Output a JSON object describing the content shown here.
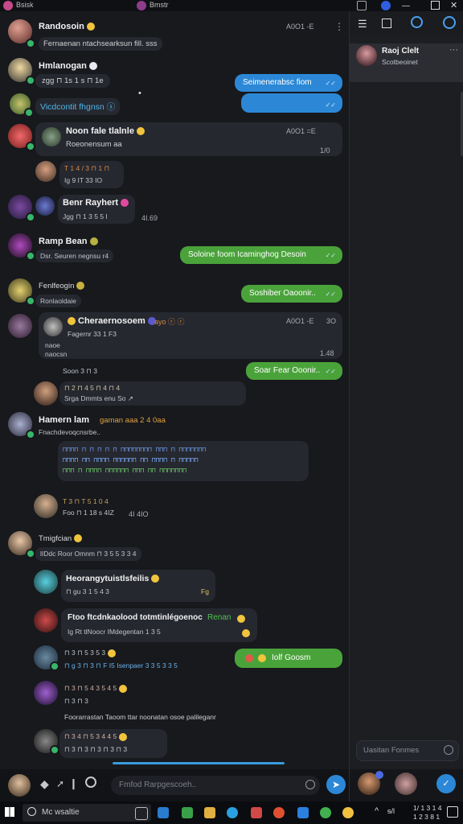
{
  "window": {
    "tab1": "Bsisk",
    "tab2": "Bmstr"
  },
  "chat": {
    "messages": [
      {
        "name": "Randosoin",
        "sub": "Fernaenan ntachsearksun fill.  sss",
        "meta": "A0O1 -E"
      },
      {
        "name": "Hmlanogan",
        "sub": "zgg ⊓ 1s 1 s ⊓ 1e"
      },
      {
        "name": "Vicdcontit fhgnsn  ⓢ"
      },
      {
        "name": "Noon fale tlalnle",
        "sub": "Roeonensum aa",
        "meta": "A0O1 =E",
        "meta2": "1/0"
      },
      {
        "name": "T 1 4 / 3 ⊓ 1 ⊓",
        "sub": "Ig 9 IT 33 IO"
      },
      {
        "name": "Benr Rayhert",
        "sub": "Jgg ⊓ 1 3 5 5 I",
        "meta": "4I.69"
      },
      {
        "name": "Ramp Bean",
        "sub": "Dsr. Seuren negnsu  r4"
      },
      {
        "name": "Fenlfeogin",
        "sub": "Ronlaoldaie"
      },
      {
        "name": "Cheraernosoem",
        "sub": "Fagernr 33 1 F3",
        "meta": "A0O1 -E",
        "meta2": "3O",
        "line2": "naoe",
        "line3": "naocsn",
        "tail": "1.48"
      },
      {
        "sub": "Soon  3 ⊓ 3"
      },
      {
        "name": "⊓ 2 ⊓ 4 5 ⊓ 4 ⊓ 4",
        "sub": "Srga  Dmmts enu  So  ↗"
      },
      {
        "name": "Hamern lam",
        "extra": "gaman  aaa  2 4 0aa",
        "sub": "Fnachdevoqcnsrbe.."
      },
      {
        "name": "T 3 ⊓ T 5 1 0 4",
        "sub": "Foo  ⊓ 1 18 s 4IZ",
        "meta": "4I 4IO"
      },
      {
        "name": "Tmigfcian",
        "sub": "lIDdc  Roor  Omnm  ⊓ 3 5 5 3 3 4"
      },
      {
        "name": "Heorangytuistlsfeilis",
        "sub": "⊓ gu 3 1 5 4 3",
        "tail": "Fg"
      },
      {
        "name": "Ftoo ftcdnkaolood totmtinlégoenoc",
        "green": "Renan",
        "sub": "Ig Rt  tlNoocr IMdegentan  1 3 5"
      },
      {
        "name": "⊓ 3 ⊓ 5 3 5 3",
        "sub": "⊓ g 3 ⊓ 3 ⊓ F I5 Isenpaer 3 3 5 3 3 5"
      },
      {
        "name": "⊓ 3 ⊓ 5 4 3 5 4 5",
        "sub": "⊓ 3 ⊓ 3"
      },
      {
        "line": "Foorarrastan  Taoom  ttar  noonatan  osoe  palileganr"
      },
      {
        "name": "⊓ 3 4 ⊓ 5 3 4 4 5",
        "sub": "⊓ 3 ⊓ 3 ⊓ 3 ⊓ 3 ⊓ 3"
      }
    ],
    "outgoing": [
      {
        "text": "Seimenerabsc  fiom"
      },
      {
        "text": "Soloine  foom  Icaminghog  Desoin"
      },
      {
        "text": "Soshiber  Oaoonir.."
      },
      {
        "text": "Soar  Fear  Ooonir.."
      },
      {
        "text": "Iolf  Goosm"
      }
    ],
    "code_block": {
      "l1": "⊓⊓⊓⊓ ⊓ ⊓ ⊓ ⊓ ⊓  ⊓⊓⊓⊓⊓⊓⊓⊓  ⊓⊓⊓ ⊓ ⊓⊓⊓⊓⊓⊓⊓",
      "l2": "⊓⊓⊓⊓ ⊓⊓ ⊓⊓⊓⊓ ⊓⊓⊓⊓⊓⊓ ⊓⊓ ⊓⊓⊓⊓ ⊓ ⊓⊓⊓⊓⊓",
      "l3": "⊓⊓⊓ ⊓ ⊓⊓⊓⊓ ⊓⊓⊓⊓⊓⊓ ⊓⊓⊓ ⊓⊓ ⊓⊓⊓⊓⊓⊓⊓"
    },
    "composer": {
      "placeholder": "Fmfod  Rarpgescoeh.."
    }
  },
  "sidebar": {
    "contact_name": "Raoj Clelt",
    "contact_status": "Scotbeoinet",
    "search_placeholder": "Uasitan  Fonmes"
  },
  "taskbar": {
    "search": "Mc  wsaltie",
    "time": "1/ 1 3 1 4",
    "date": "1 2 3 8 1"
  },
  "colors": {
    "outgoing_blue": "#2c88d6",
    "outgoing_green": "#4aa33a",
    "bubble": "#262830",
    "background": "#17191d"
  }
}
